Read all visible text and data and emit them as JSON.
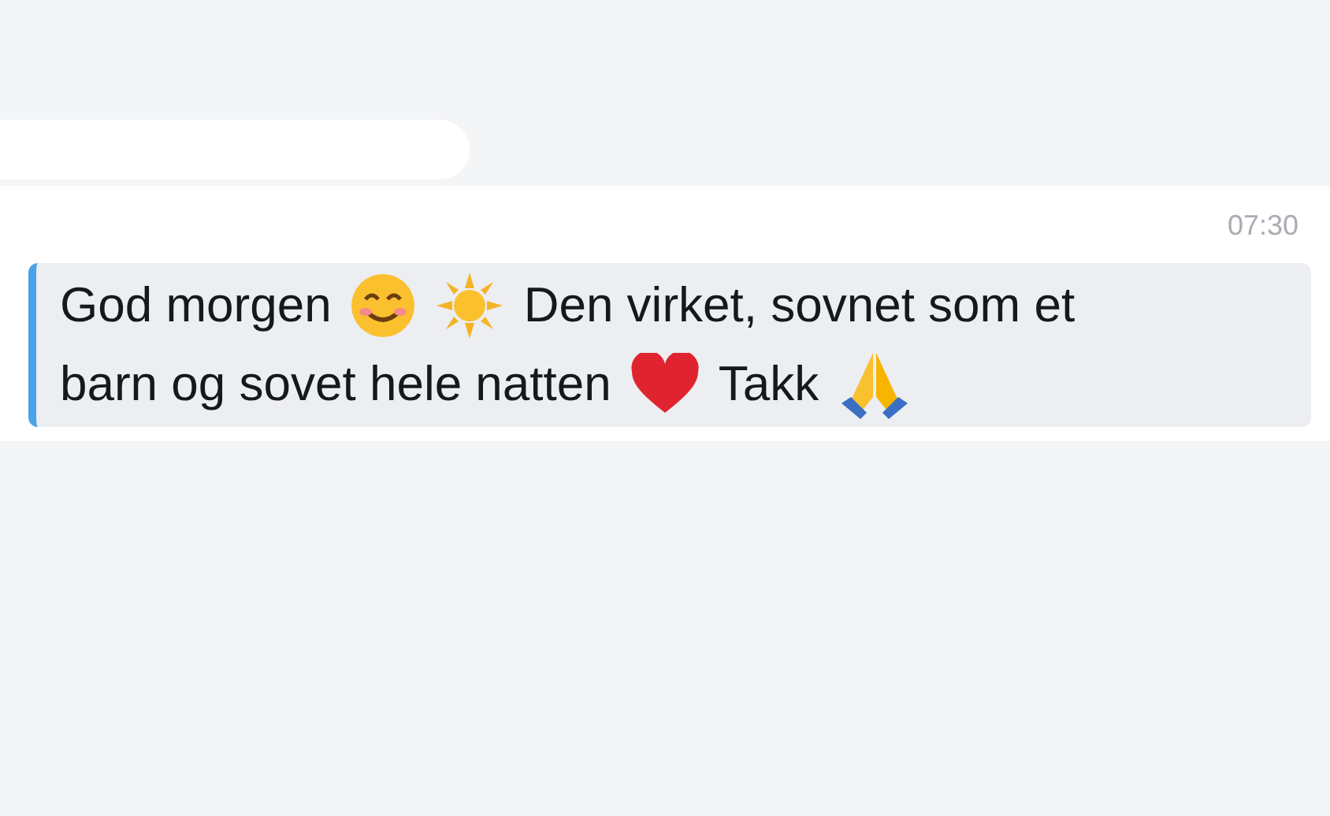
{
  "message": {
    "time": "07:30",
    "lines": [
      [
        {
          "kind": "text",
          "text": "God morgen"
        },
        {
          "kind": "smile"
        },
        {
          "kind": "sun"
        },
        {
          "kind": "text",
          "text": "Den virket, sovnet som et"
        }
      ],
      [
        {
          "kind": "text",
          "text": "barn og sovet hele natten"
        },
        {
          "kind": "heart"
        },
        {
          "kind": "text",
          "text": "Takk"
        },
        {
          "kind": "pray"
        }
      ]
    ]
  }
}
